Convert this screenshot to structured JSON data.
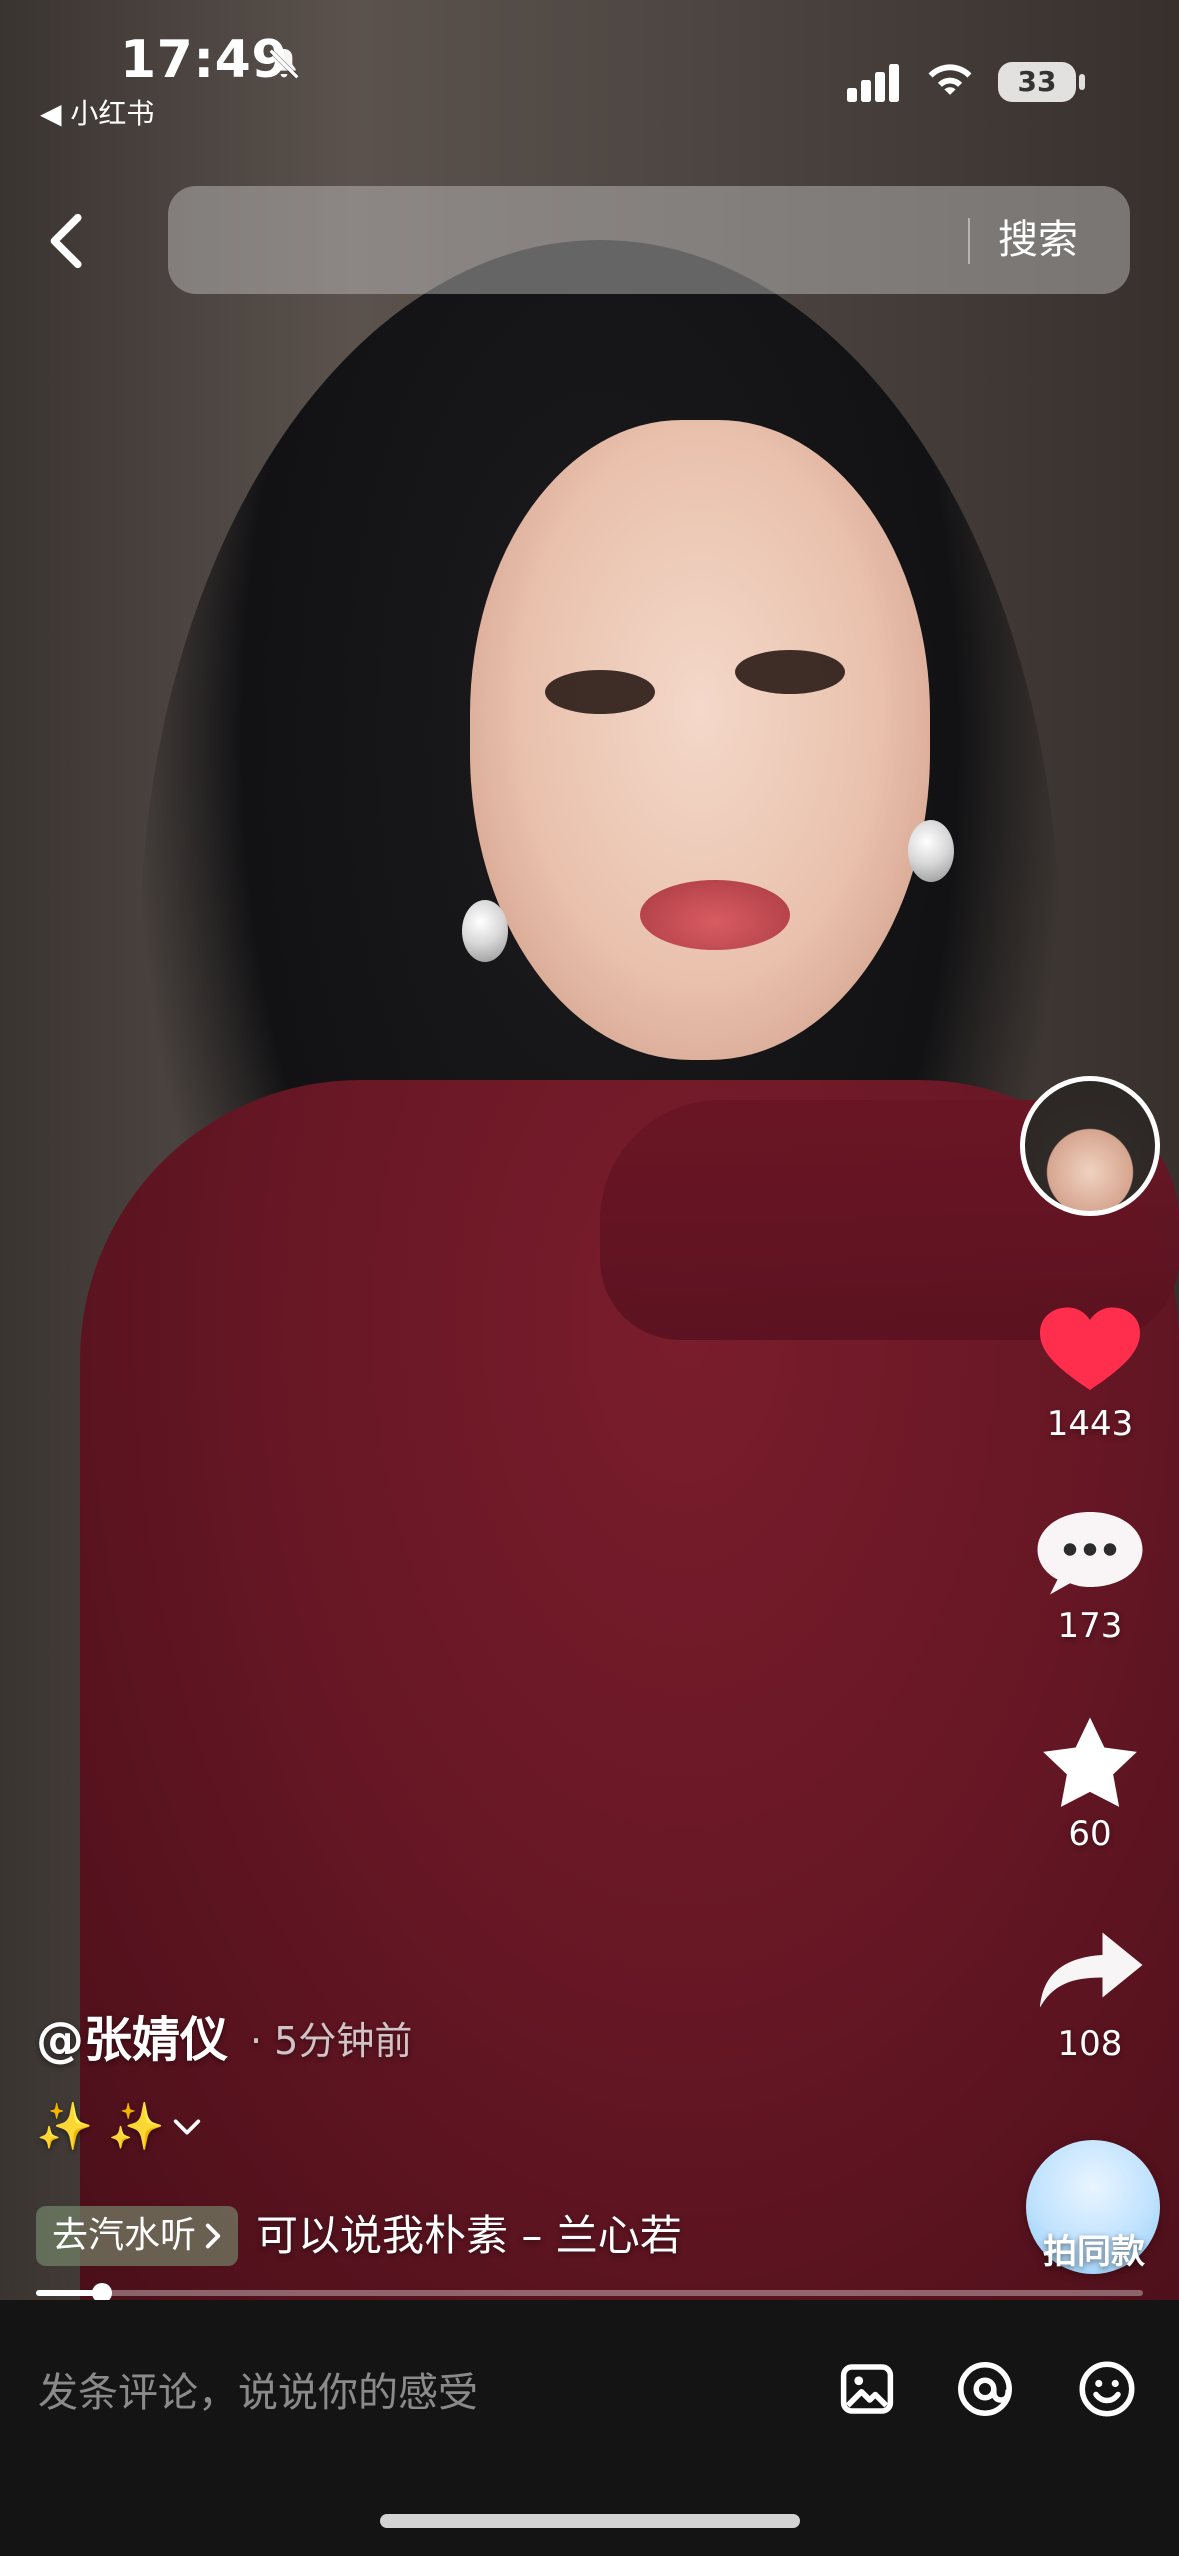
{
  "status_bar": {
    "time": "17:49",
    "back_app_label": "◀ 小红书",
    "battery": "33"
  },
  "top_nav": {
    "search_placeholder": "",
    "search_button": "搜索"
  },
  "rail": {
    "likes": "1443",
    "comments": "173",
    "favorites": "60",
    "shares": "108",
    "same_style_label": "拍同款",
    "like_color": "#ff2e4d"
  },
  "post": {
    "author": "@张婧仪",
    "time_ago": "· 5分钟前",
    "description": "✨ ✨",
    "music_chip": "去汽水听",
    "music_title": "可以说我朴素 – 兰心若",
    "progress": 0.06
  },
  "comment_bar": {
    "placeholder": "发条评论，说说你的感受"
  },
  "icons": {
    "status": [
      "bell-off-icon",
      "cellular-signal-icon",
      "wifi-icon",
      "battery-icon"
    ],
    "top": [
      "back-chevron-icon",
      "search-icon"
    ],
    "rail": [
      "heart-icon",
      "comment-bubble-icon",
      "star-icon",
      "share-arrow-icon"
    ],
    "comment_bar": [
      "image-icon",
      "at-sign-icon",
      "emoji-icon"
    ]
  }
}
